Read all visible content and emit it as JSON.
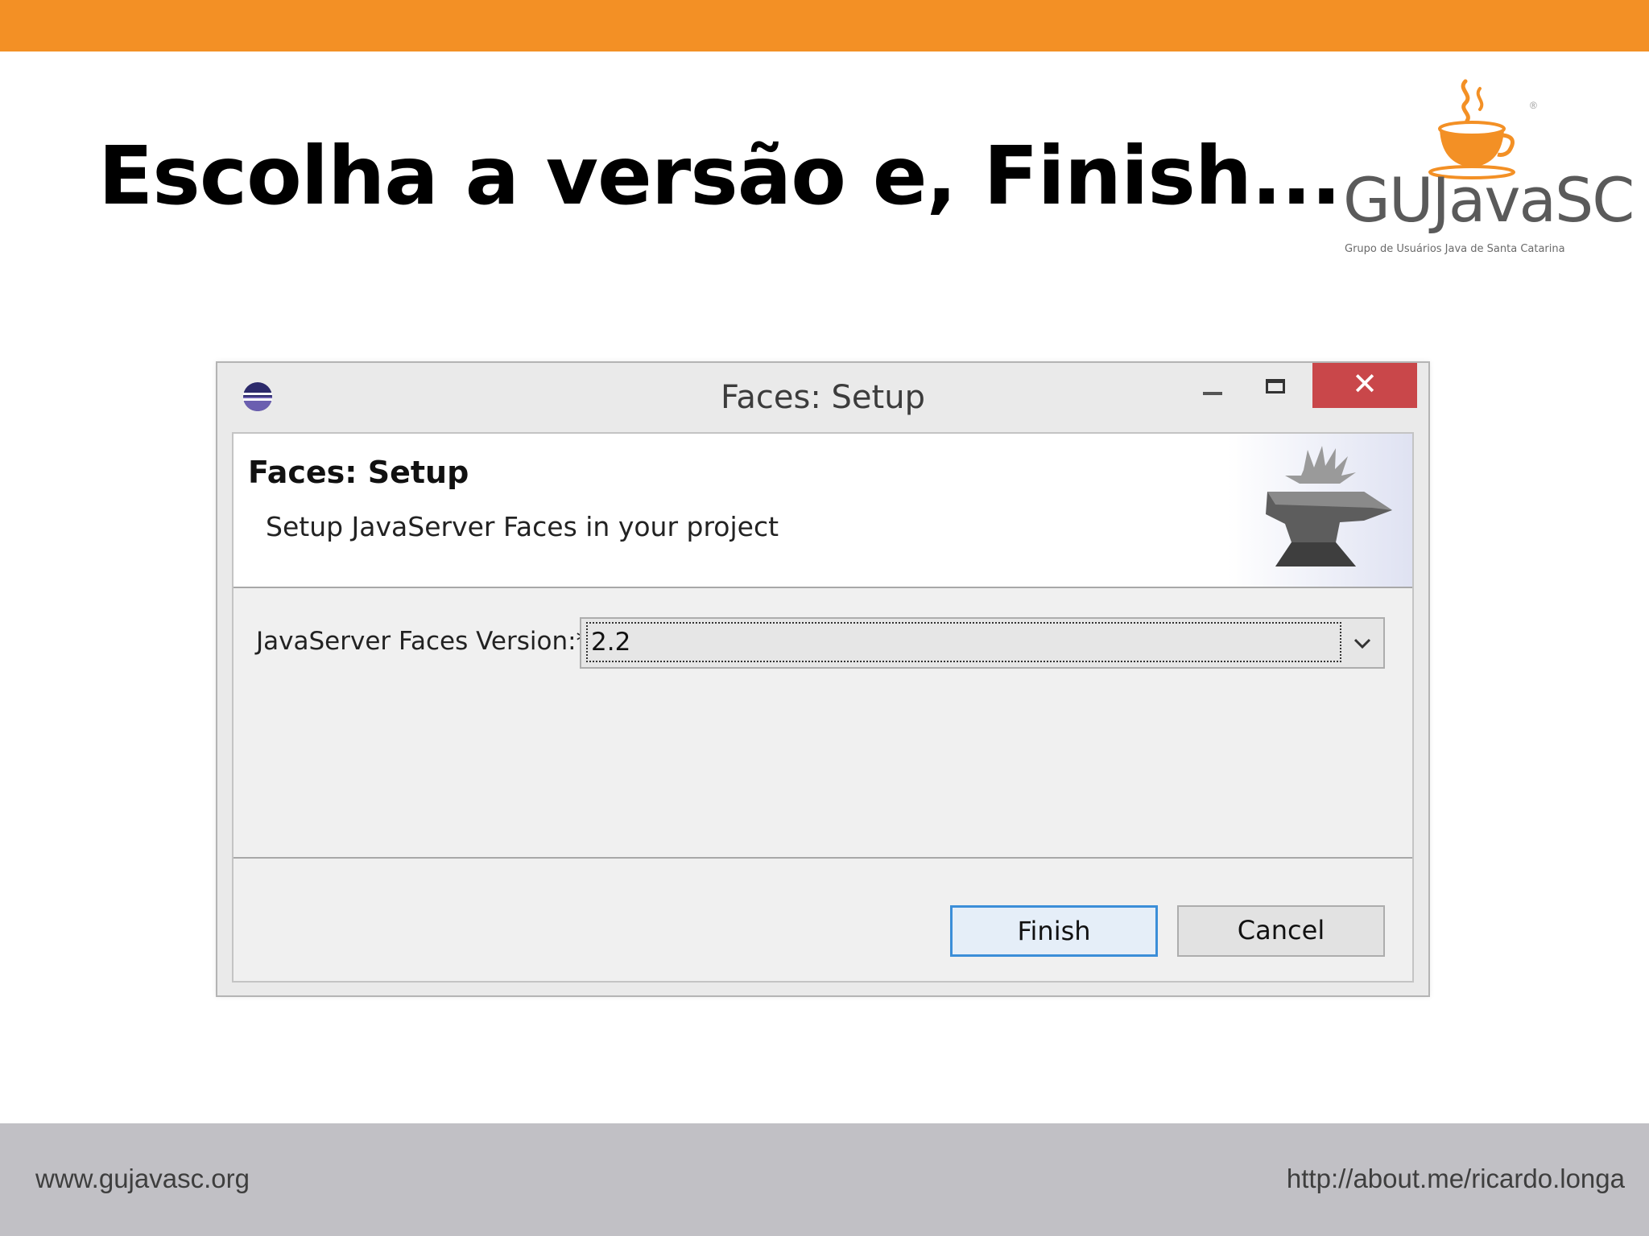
{
  "slide": {
    "title": "Escolha a versão e, Finish..."
  },
  "logo": {
    "text": "GUJavaSC",
    "subtitle": "Grupo de Usuários Java de Santa Catarina",
    "icon": "coffee-cup-icon"
  },
  "dialog": {
    "window_title": "Faces: Setup",
    "app_icon": "eclipse-icon",
    "banner_title": "Faces: Setup",
    "banner_description": "Setup JavaServer Faces in your project",
    "banner_image": "anvil-icon",
    "version_label": "JavaServer Faces Version:*",
    "version_value": "2.2",
    "finish_label": "Finish",
    "cancel_label": "Cancel"
  },
  "footer": {
    "left": "www.gujavasc.org",
    "right": "http://about.me/ricardo.longa"
  },
  "colors": {
    "accent": "#f39025",
    "close_button": "#c9474a",
    "footer": "#c1c0c5",
    "focus_border": "#3b8ed8"
  }
}
